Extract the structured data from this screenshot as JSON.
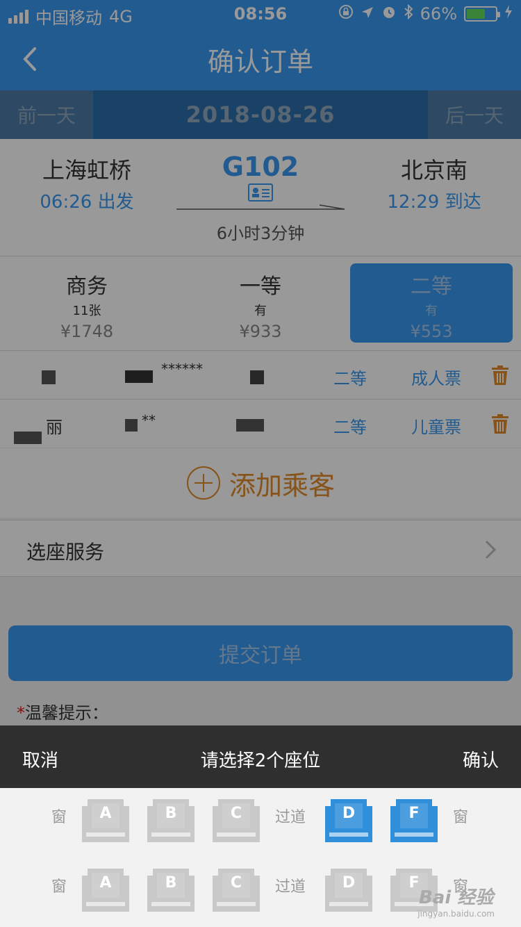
{
  "status": {
    "carrier": "中国移动",
    "network": "4G",
    "time": "08:56",
    "battery": "66%",
    "battery_level": 0.66
  },
  "nav": {
    "title": "确认订单"
  },
  "datebar": {
    "prev": "前一天",
    "date": "2018-08-26",
    "next": "后一天"
  },
  "train": {
    "from_station": "上海虹桥",
    "from_time": "06:26 出发",
    "train_no": "G102",
    "to_station": "北京南",
    "to_time": "12:29 到达",
    "duration": "6小时3分钟"
  },
  "seat_classes": [
    {
      "name": "商务",
      "avail": "11张",
      "price": "¥1748"
    },
    {
      "name": "一等",
      "avail": "有",
      "price": "¥933"
    },
    {
      "name": "二等",
      "avail": "有",
      "price": "¥553"
    }
  ],
  "passengers": [
    {
      "masked": "******",
      "seat": "二等",
      "type": "成人票"
    },
    {
      "masked_name": "丽",
      "masked": "**",
      "seat": "二等",
      "type": "儿童票"
    }
  ],
  "add_passenger": "添加乘客",
  "seat_service": "选座服务",
  "submit": "提交订单",
  "tip": {
    "star": "*",
    "label": "温馨提示："
  },
  "sheet": {
    "cancel": "取消",
    "title": "请选择2个座位",
    "confirm": "确认"
  },
  "seat_rows": [
    {
      "window_left": "窗",
      "aisle": "过道",
      "window_right": "窗",
      "seats": [
        {
          "letter": "A",
          "selected": false
        },
        {
          "letter": "B",
          "selected": false
        },
        {
          "letter": "C",
          "selected": false
        },
        {
          "letter": "D",
          "selected": true
        },
        {
          "letter": "F",
          "selected": true
        }
      ]
    },
    {
      "window_left": "窗",
      "aisle": "过道",
      "window_right": "窗",
      "seats": [
        {
          "letter": "A",
          "selected": false
        },
        {
          "letter": "B",
          "selected": false
        },
        {
          "letter": "C",
          "selected": false
        },
        {
          "letter": "D",
          "selected": false
        },
        {
          "letter": "F",
          "selected": false
        }
      ]
    }
  ],
  "colors": {
    "primary": "#3a98ef",
    "seat_selected": "#2f8fdb",
    "seat_default": "#c9c9c9",
    "accent": "#e18a2a"
  },
  "watermark": {
    "brand": "Bai 经验",
    "url": "jingyan.baidu.com"
  }
}
